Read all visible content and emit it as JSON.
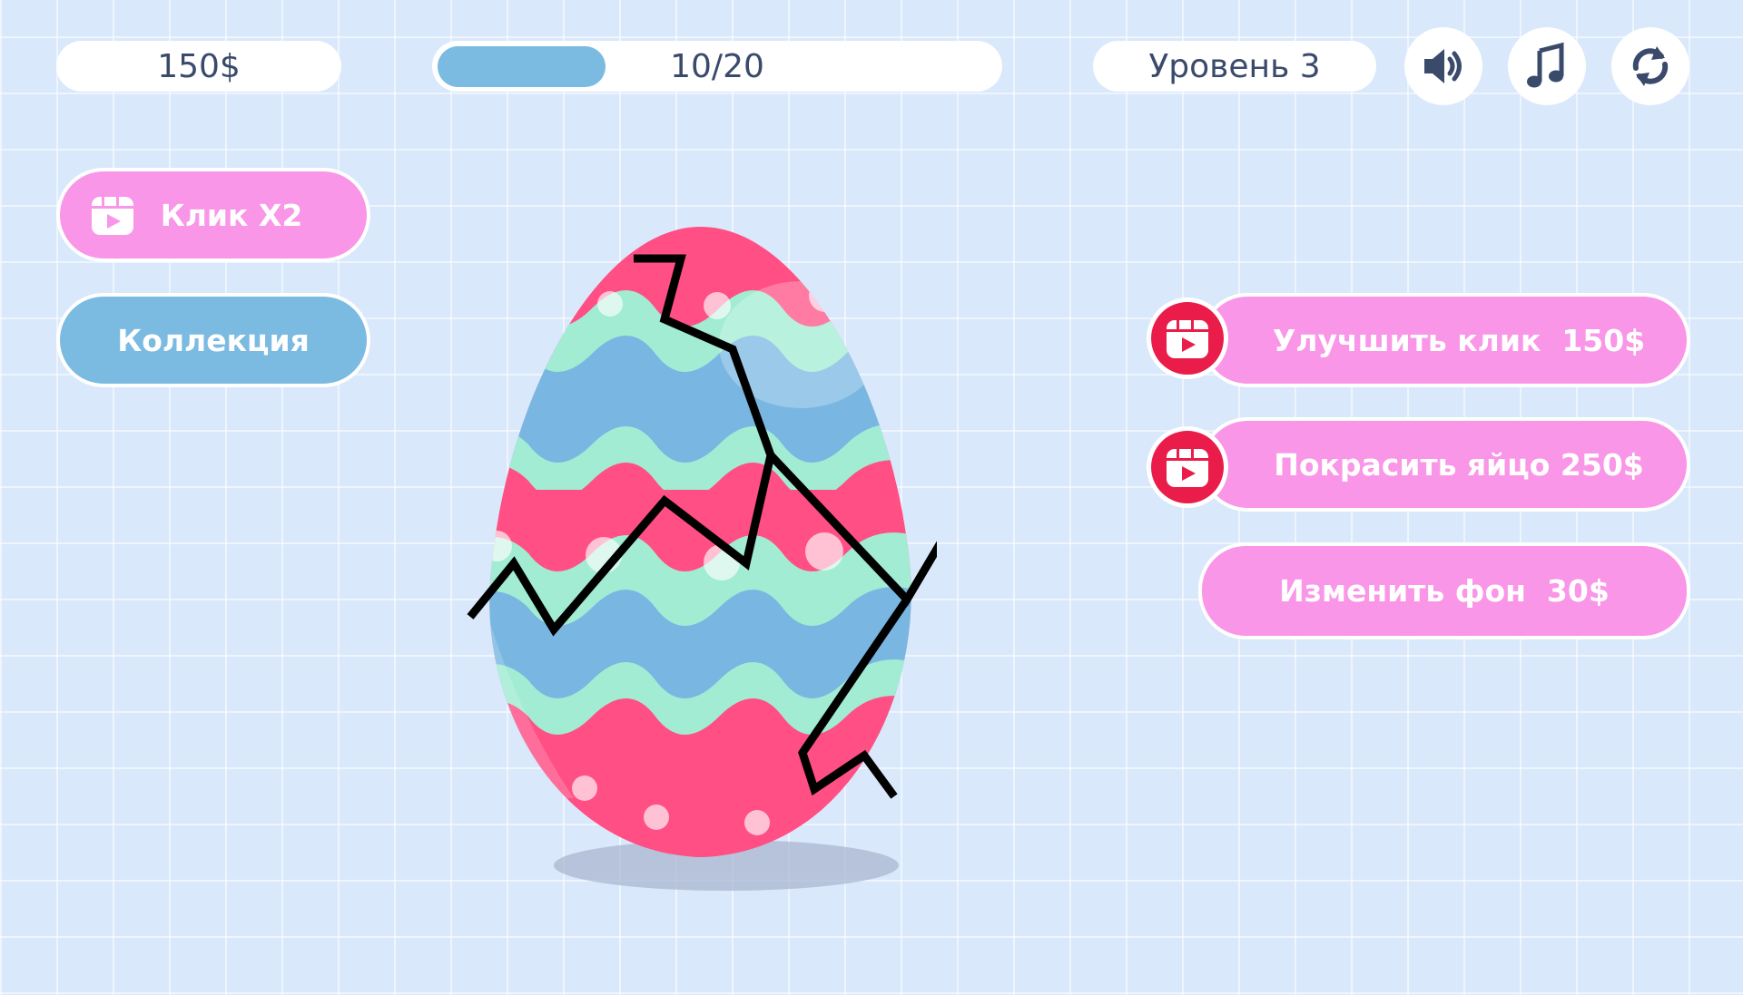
{
  "hud": {
    "money": "150$",
    "progress_text": "10/20",
    "progress_fraction": 0.5,
    "level": "Уровень 3"
  },
  "icons": {
    "sound": "speaker-icon",
    "music": "music-note-icon",
    "restart": "refresh-icon",
    "ad": "video-play-icon"
  },
  "left_buttons": {
    "double_click_label": "Клик X2",
    "collection_label": "Коллекция"
  },
  "shop": {
    "upgrade_click_label": "Улучшить клик  150$",
    "paint_egg_label": "Покрасить яйцо 250$",
    "change_background_label": "Изменить фон  30$"
  },
  "colors": {
    "accent_pink": "#f996e7",
    "accent_blue": "#7bbbe2",
    "ad_red": "#ea1c4a",
    "egg_pink": "#ff4f84",
    "egg_blue": "#79b7e2",
    "egg_mint": "#a2ecd4"
  }
}
